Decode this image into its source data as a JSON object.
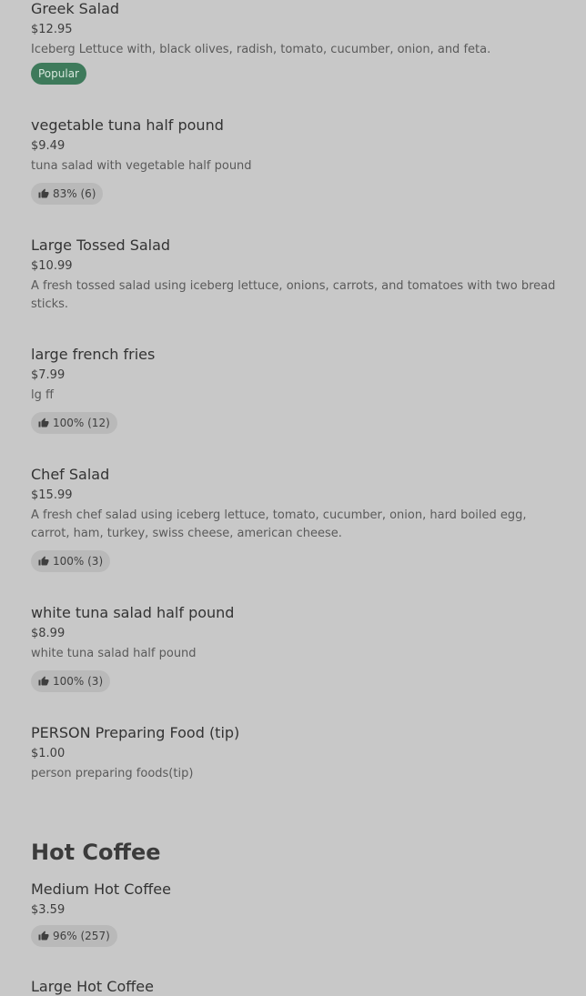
{
  "items": [
    {
      "name": "Greek Salad",
      "price": "$12.95",
      "description": "Iceberg Lettuce with, black olives, radish, tomato, cucumber, onion, and feta.",
      "badge": "Popular"
    },
    {
      "name": "vegetable tuna half pound",
      "price": "$9.49",
      "description": "tuna salad with vegetable half pound",
      "rating": "83% (6)"
    },
    {
      "name": "Large Tossed Salad",
      "price": "$10.99",
      "description": "A fresh tossed salad using iceberg lettuce, onions, carrots, and tomatoes with two bread sticks."
    },
    {
      "name": "large french fries",
      "price": "$7.99",
      "description": "lg ff",
      "rating": "100% (12)"
    },
    {
      "name": "Chef Salad",
      "price": "$15.99",
      "description": "A fresh chef salad using iceberg lettuce, tomato, cucumber, onion, hard boiled egg, carrot, ham, turkey, swiss cheese, american cheese.",
      "rating": "100% (3)"
    },
    {
      "name": "white tuna salad half pound",
      "price": "$8.99",
      "description": "white tuna salad half pound",
      "rating": "100% (3)"
    },
    {
      "name": "PERSON Preparing Food (tip)",
      "price": "$1.00",
      "description": "person preparing foods(tip)"
    }
  ],
  "hot_coffee": {
    "title": "Hot Coffee",
    "items": [
      {
        "name": "Medium Hot Coffee",
        "price": "$3.59",
        "rating": "96% (257)"
      },
      {
        "name": "Large Hot Coffee"
      }
    ]
  },
  "icons": {
    "rating": "thumbs-up-icon"
  },
  "colors": {
    "background": "#c8c8c8",
    "popular_badge": "#3e7a5b",
    "rating_chip": "#b9b9b9"
  }
}
